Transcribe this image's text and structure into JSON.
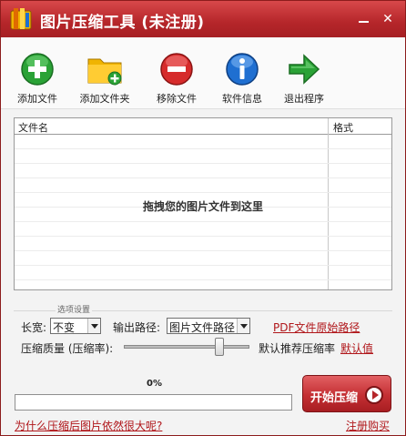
{
  "window": {
    "title": "图片压缩工具 (未注册)",
    "app_icon": "app-icon",
    "minimize_icon": "minimize-icon",
    "close_icon": "close-icon"
  },
  "toolbar": {
    "items": [
      {
        "label": "添加文件",
        "icon": "add-file-icon",
        "color": "#2aa236"
      },
      {
        "label": "添加文件夹",
        "icon": "add-folder-icon",
        "color": "#f0b400"
      },
      {
        "label": "移除文件",
        "icon": "remove-file-icon",
        "color": "#d62b2b"
      },
      {
        "label": "软件信息",
        "icon": "info-icon",
        "color": "#1f6fd1"
      },
      {
        "label": "退出程序",
        "icon": "exit-arrow-icon",
        "color": "#2aa236"
      }
    ]
  },
  "file_list": {
    "columns": [
      "文件名",
      "格式"
    ],
    "rows": [],
    "drop_hint": "拖拽您的图片文件到这里"
  },
  "options": {
    "group_title": "选项设置",
    "size_label": "长宽:",
    "size_value": "不变",
    "output_label": "输出路径:",
    "output_value": "图片文件路径",
    "pdf_link": "PDF文件原始路径",
    "quality_label": "压缩质量 (压缩率):",
    "quality_level": 0.78,
    "recommend_text": "默认推荐压缩率",
    "default_link": "默认值"
  },
  "progress": {
    "percent_text": "0%",
    "value": 0
  },
  "start_button": {
    "label": "开始压缩"
  },
  "footer": {
    "help_link": "为什么压缩后图片依然很大呢?",
    "register_link": "注册购买"
  },
  "colors": {
    "accent": "#b5262a",
    "link": "#b0161a"
  }
}
